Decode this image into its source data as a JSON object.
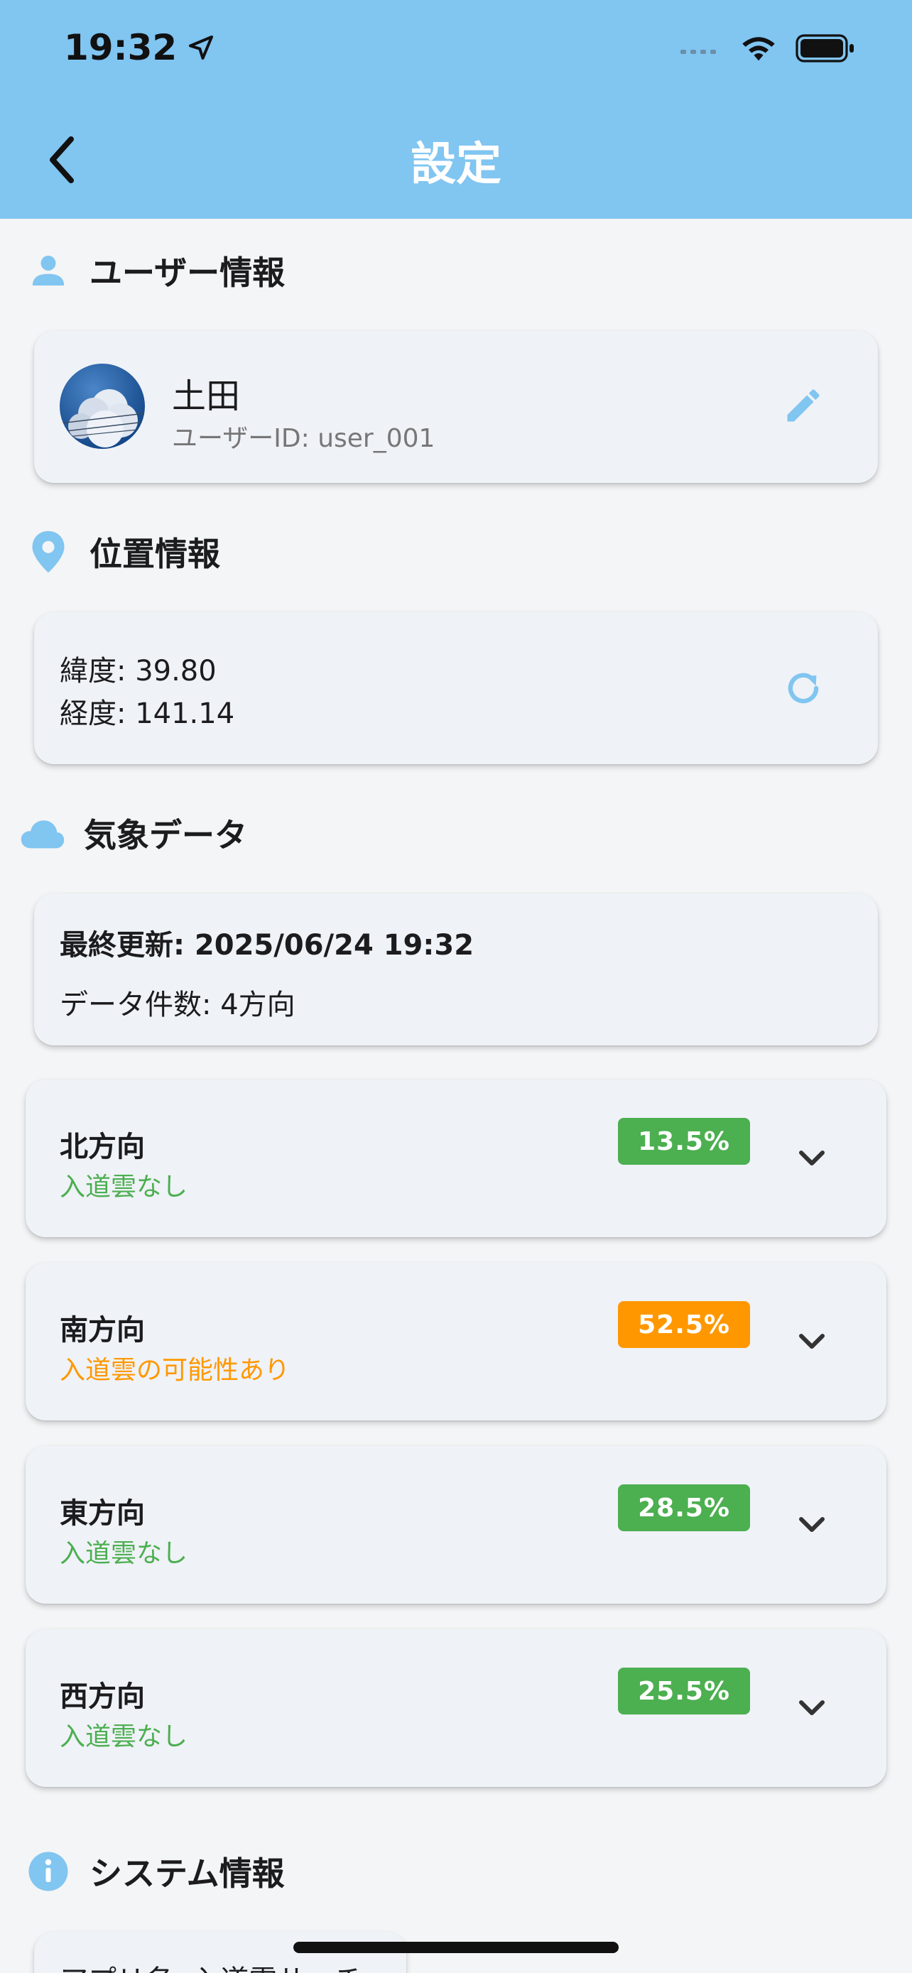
{
  "status_bar": {
    "time": "19:32"
  },
  "header": {
    "title": "設定"
  },
  "sections": {
    "user": {
      "title": "ユーザー情報"
    },
    "location": {
      "title": "位置情報"
    },
    "weather": {
      "title": "気象データ"
    },
    "system": {
      "title": "システム情報"
    }
  },
  "user": {
    "name": "土田",
    "user_id": "ユーザーID: user_001"
  },
  "location": {
    "latitude": "緯度: 39.80",
    "longitude": "経度: 141.14"
  },
  "weather": {
    "last_updated": "最終更新: 2025/06/24 19:32",
    "data_count": "データ件数: 4方向"
  },
  "directions": [
    {
      "name": "北方向",
      "status": "入道雲なし",
      "percent": "13.5%"
    },
    {
      "name": "南方向",
      "status": "入道雲の可能性あり",
      "percent": "52.5%"
    },
    {
      "name": "東方向",
      "status": "入道雲なし",
      "percent": "28.5%"
    },
    {
      "name": "西方向",
      "status": "入道雲なし",
      "percent": "25.5%"
    }
  ],
  "system": {
    "app_name": "アプリ名: 入道雲サーチ"
  },
  "colors": {
    "header_bg": "#81c5f1",
    "accent_blue": "#81c5f1",
    "green": "#4caf50",
    "orange": "#ff9800"
  },
  "icons": {
    "back": "chevron-left-icon",
    "user": "person-icon",
    "location": "location-pin-icon",
    "weather": "cloud-icon",
    "system": "info-icon",
    "edit": "pencil-icon",
    "refresh": "refresh-icon",
    "expand": "chevron-down-icon"
  }
}
